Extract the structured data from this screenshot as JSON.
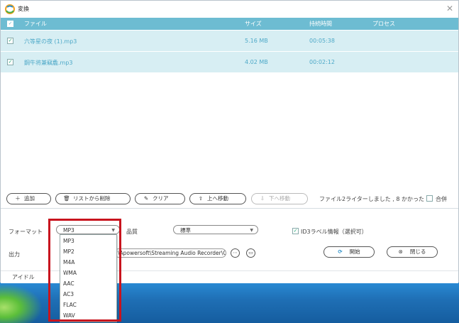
{
  "window": {
    "title": "変換"
  },
  "table": {
    "columns": [
      "ファイル",
      "サイズ",
      "持続時間",
      "プロセス"
    ],
    "rows": [
      {
        "checked": true,
        "file": "六等星の夜 (1).mp3",
        "size": "5.16 MB",
        "duration": "00:05:38",
        "process": ""
      },
      {
        "checked": true,
        "file": "鋼牛将兼竊麁.mp3",
        "size": "4.02 MB",
        "duration": "00:02:12",
        "process": ""
      }
    ]
  },
  "toolbar": {
    "add": "追加",
    "remove": "リストから削除",
    "clear": "クリア",
    "move_up": "上へ移動",
    "move_down": "下へ移動",
    "status_text": "ファイル2ライターしました , 8 かかった",
    "merge_label": "合併",
    "merge_checked": false
  },
  "settings": {
    "format_label": "フォーマット",
    "format_value": "MP3",
    "quality_label": "品質",
    "quality_value": "標準",
    "id3_label": "ID3ラベル情報（選択可）",
    "id3_checked": true,
    "output_label": "出力",
    "output_path": "\\Apowersoft\\Streaming Audio Recorder\\C...",
    "start_button": "開始",
    "close_button": "閉じる"
  },
  "format_options": [
    "MP3",
    "MP2",
    "M4A",
    "WMA",
    "AAC",
    "AC3",
    "FLAC",
    "WAV"
  ],
  "status_bar": {
    "text": "アイドル"
  },
  "colors": {
    "header_bg": "#6dbcd2",
    "row_bg": "#d7eef3",
    "row_text": "#4ea9c8",
    "highlight_border": "#c8141e",
    "accent_icon": "#2b8fc7"
  }
}
